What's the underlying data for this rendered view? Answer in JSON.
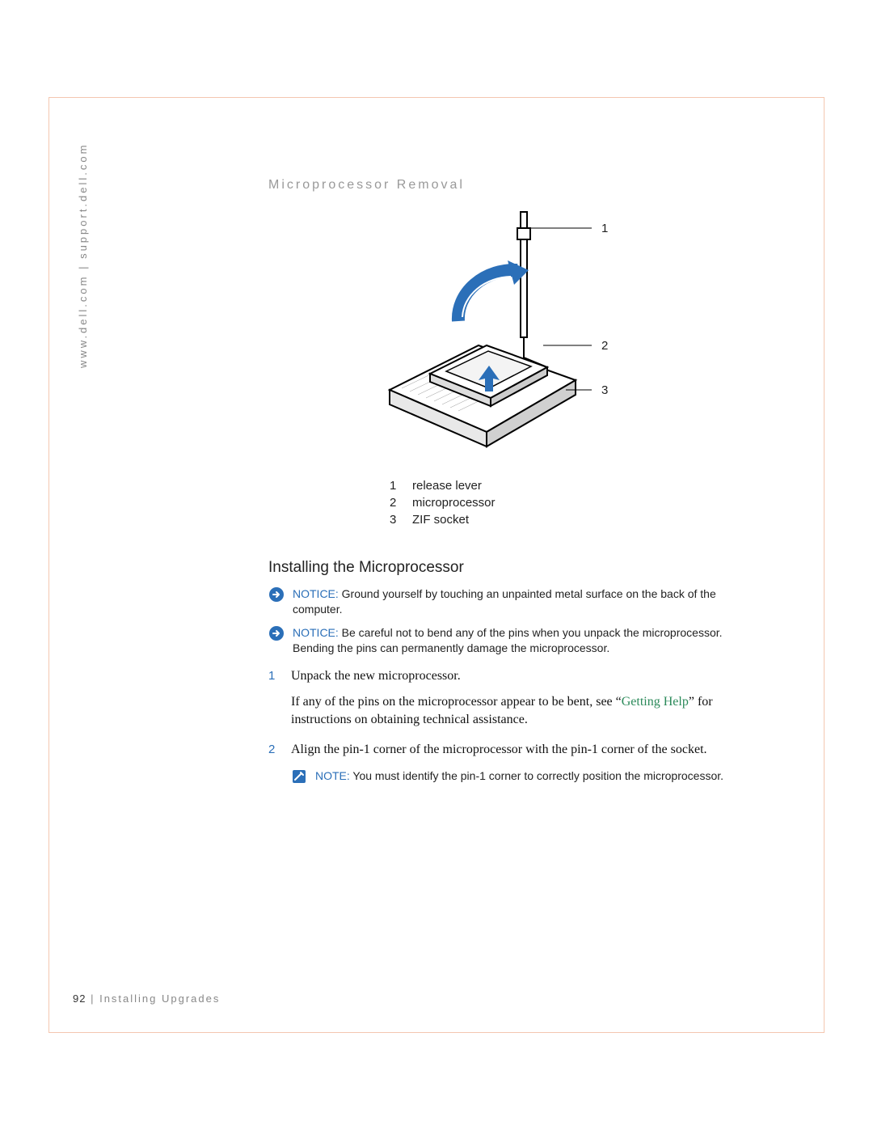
{
  "side_url": "www.dell.com | support.dell.com",
  "figure_title": "Microprocessor Removal",
  "callouts": {
    "c1": "1",
    "c2": "2",
    "c3": "3"
  },
  "legend": [
    {
      "num": "1",
      "label": "release lever"
    },
    {
      "num": "2",
      "label": "microprocessor"
    },
    {
      "num": "3",
      "label": "ZIF socket"
    }
  ],
  "subheading": "Installing the Microprocessor",
  "notices": [
    {
      "label": "NOTICE:",
      "text": " Ground yourself by touching an unpainted metal surface on the back of the computer."
    },
    {
      "label": "NOTICE:",
      "text": " Be careful not to bend any of the pins when you unpack the microprocessor. Bending the pins can permanently damage the microprocessor."
    }
  ],
  "steps": [
    {
      "num": "1",
      "text": "Unpack the new microprocessor.",
      "sub_pre": "If any of the pins on the microprocessor appear to be bent, see “",
      "sub_link": "Getting Help",
      "sub_post": "” for instructions on obtaining technical assistance."
    },
    {
      "num": "2",
      "text": "Align the pin-1 corner of the microprocessor with the pin-1 corner of the socket."
    }
  ],
  "inner_note": {
    "label": "NOTE:",
    "text": " You must identify the pin-1 corner to correctly position the microprocessor."
  },
  "footer": {
    "page": "92",
    "sep": " | ",
    "chapter": "Installing Upgrades"
  }
}
